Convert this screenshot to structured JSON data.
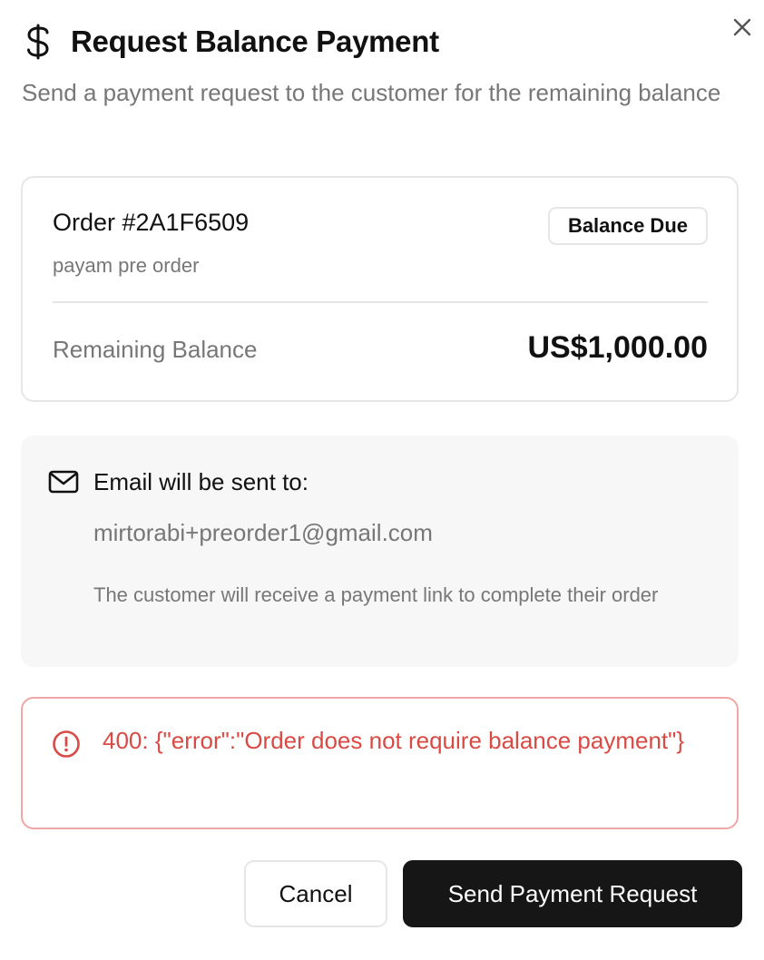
{
  "dialog": {
    "title": "Request Balance Payment",
    "subtitle": "Send a payment request to the customer for the remaining balance",
    "title_icon": "dollar-icon",
    "close_icon": "close-icon"
  },
  "order": {
    "number": "Order #2A1F6509",
    "name": "payam pre order",
    "badge": "Balance Due",
    "balance_label": "Remaining Balance",
    "balance_value": "US$1,000.00"
  },
  "email": {
    "icon": "mail-icon",
    "heading": "Email will be sent to:",
    "address": "mirtorabi+preorder1@gmail.com",
    "note": "The customer will receive a payment link to complete their order"
  },
  "error": {
    "icon": "alert-circle-icon",
    "message": "400: {\"error\":\"Order does not require balance payment\"}"
  },
  "actions": {
    "cancel_label": "Cancel",
    "send_label": "Send Payment Request"
  },
  "colors": {
    "error": "#d94a45",
    "error_border": "#eea7a4",
    "primary_button": "#161616",
    "muted_text": "#777777"
  }
}
